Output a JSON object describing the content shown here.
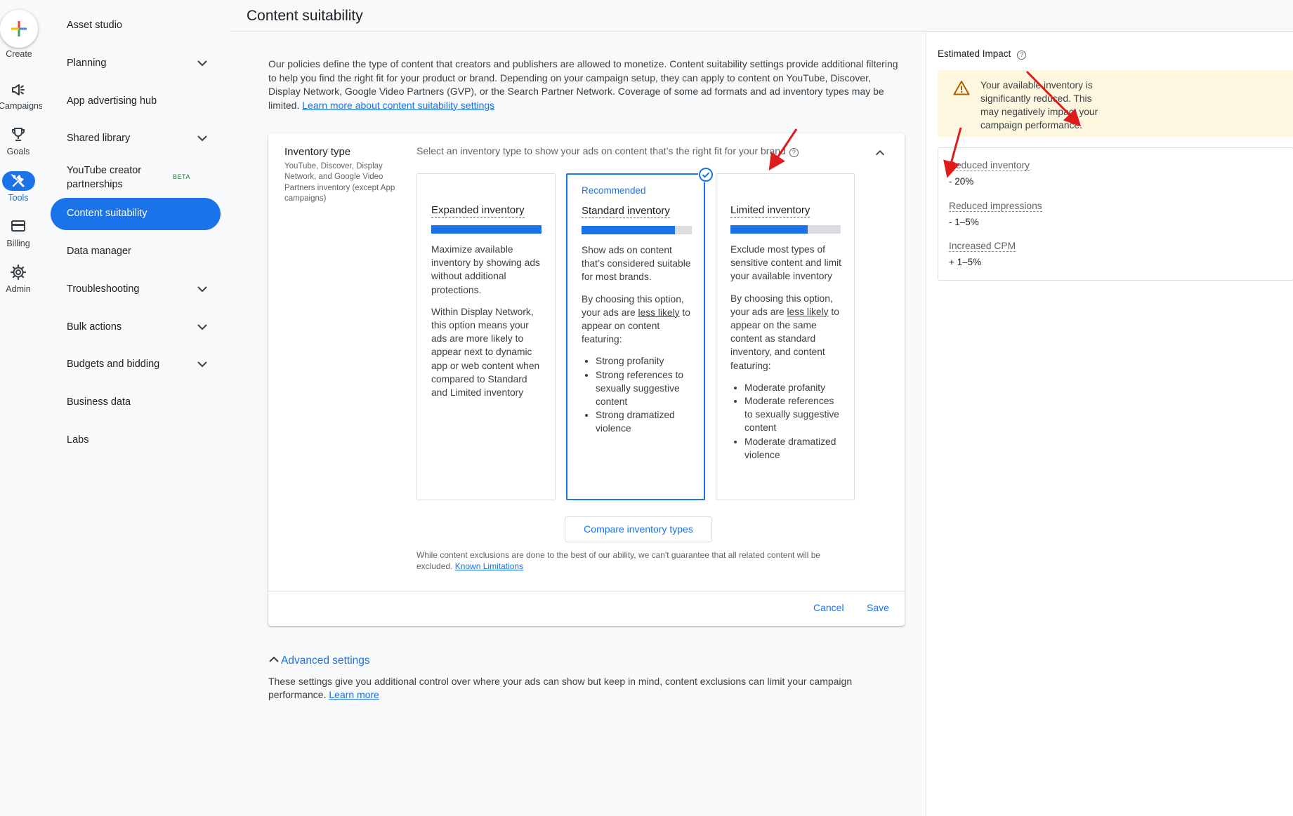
{
  "rail": {
    "create": "Create",
    "campaigns": "Campaigns",
    "goals": "Goals",
    "tools": "Tools",
    "billing": "Billing",
    "admin": "Admin"
  },
  "sidebar": {
    "items": [
      {
        "label": "Asset studio"
      },
      {
        "label": "Planning"
      },
      {
        "label": "App advertising hub"
      },
      {
        "label": "Shared library"
      },
      {
        "label": "YouTube creator partnerships",
        "badge": "BETA"
      },
      {
        "label": "Content suitability"
      },
      {
        "label": "Data manager"
      },
      {
        "label": "Troubleshooting"
      },
      {
        "label": "Bulk actions"
      },
      {
        "label": "Budgets and bidding"
      },
      {
        "label": "Business data"
      },
      {
        "label": "Labs"
      }
    ],
    "item4_line1": "YouTube creator",
    "item4_line2": "partnerships"
  },
  "page": {
    "title": "Content suitability",
    "intro": "Our policies define the type of content that creators and publishers are allowed to monetize. Content suitability settings provide additional filtering to help you find the right fit for your product or brand. Depending on your campaign setup, they can apply to content on YouTube, Discover, Display Network, Google Video Partners (GVP), or the Search Partner Network. Coverage of some ad formats and ad inventory types may be limited. ",
    "intro_link": "Learn more about content suitability settings"
  },
  "card": {
    "title": "Inventory type",
    "subtitle": "YouTube, Discover, Display Network, and Google Video Partners inventory (except App campaigns)",
    "prompt": "Select an inventory type to show your ads on content that’s the right fit for your brand",
    "options": [
      {
        "name": "Expanded inventory",
        "fill": 1.0,
        "p1": "Maximize available inventory by showing ads without additional protections.",
        "p2": "Within Display Network, this option means your ads are more likely to appear next to dynamic app or web content when compared to Standard and Limited inventory"
      },
      {
        "tag": "Recommended",
        "name": "Standard inventory",
        "fill": 0.85,
        "selected": true,
        "p1": "Show ads on content that’s considered suitable for most brands.",
        "p2_pre": "By choosing this option, your ads are ",
        "p2_u": "less likely",
        "p2_post": " to appear on content featuring:",
        "bullets": [
          "Strong profanity",
          "Strong references to sexually suggestive content",
          "Strong dramatized violence"
        ]
      },
      {
        "name": "Limited inventory",
        "fill": 0.7,
        "p1": "Exclude most types of sensitive content and limit your available inventory",
        "p2_pre": "By choosing this option, your ads are ",
        "p2_u": "less likely",
        "p2_post": " to appear on the same content as standard inventory, and content featuring:",
        "bullets": [
          "Moderate profanity",
          "Moderate references to sexually suggestive content",
          "Moderate dramatized violence"
        ]
      }
    ],
    "compare_label": "Compare inventory types",
    "disclaimer": "While content exclusions are done to the best of our ability, we can't guarantee that all related content will be excluded. ",
    "disclaimer_link": "Known Limitations",
    "cancel_label": "Cancel",
    "save_label": "Save"
  },
  "advanced": {
    "title": "Advanced settings",
    "desc": "These settings give you additional control over where your ads can show but keep in mind, content exclusions can limit your campaign performance. ",
    "link": "Learn more"
  },
  "impact": {
    "title": "Estimated Impact",
    "warning": "Your available inventory is significantly reduced. This may negatively impact your campaign performance.",
    "metrics": [
      {
        "label": "Reduced inventory",
        "value": "- 20%"
      },
      {
        "label": "Reduced impressions",
        "value": "- 1–5%"
      },
      {
        "label": "Increased CPM",
        "value": "+ 1–5%"
      }
    ]
  },
  "colors": {
    "accent": "#1a73e8",
    "warning_bg": "#fef7e0",
    "warning_icon": "#b06000",
    "annotation_arrow": "#e01b1b"
  }
}
